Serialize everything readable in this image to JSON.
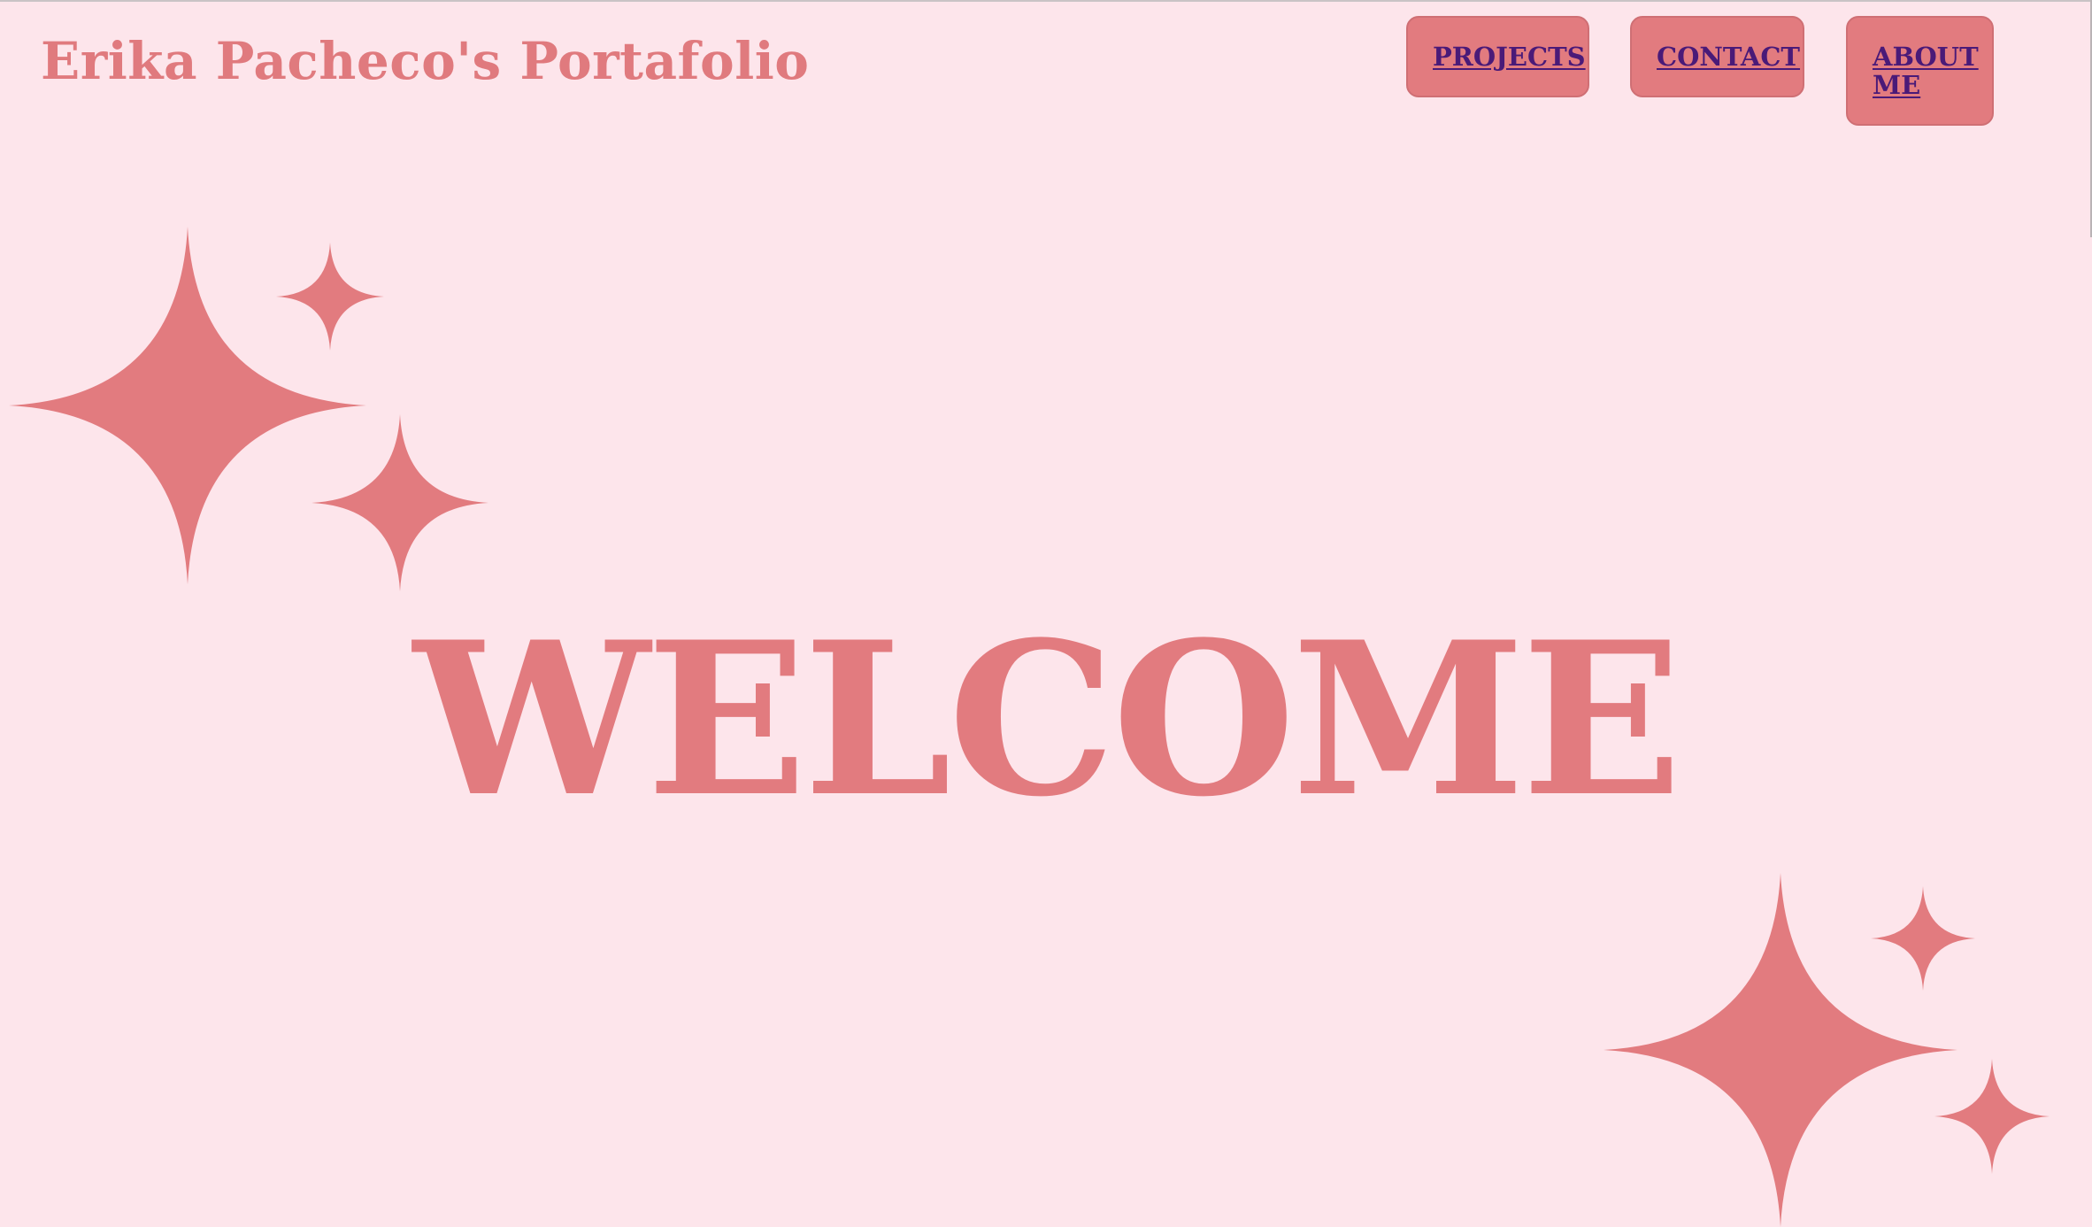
{
  "header": {
    "title": "Erika Pacheco's Portafolio"
  },
  "nav": {
    "projects_label": "PROJECTS",
    "contact_label": "CONTACT",
    "about_label": "ABOUT ME"
  },
  "hero": {
    "heading": "WELCOME"
  },
  "colors": {
    "background": "#fde5eb",
    "accent": "#e27b7f",
    "link": "#4a1a78"
  },
  "icons": {
    "decoration": "sparkle-icon"
  }
}
